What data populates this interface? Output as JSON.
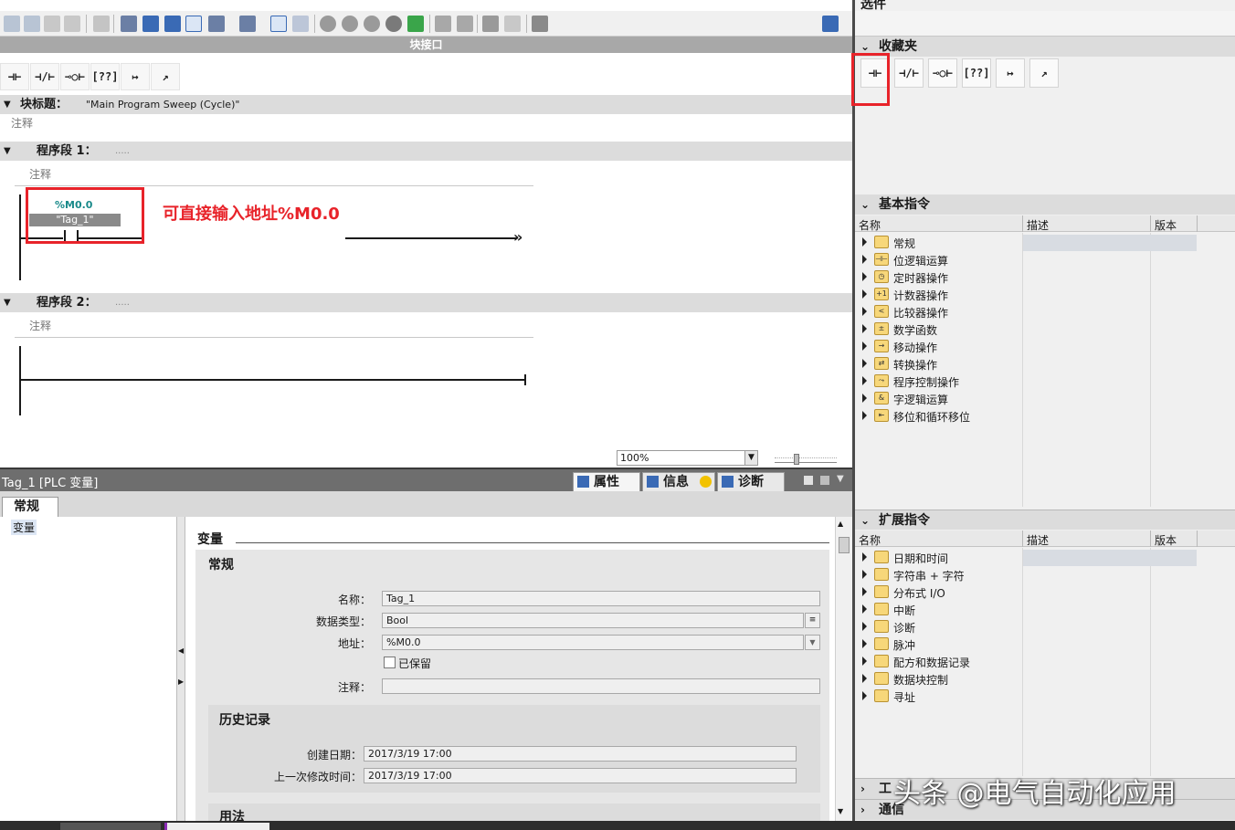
{
  "editor": {
    "block_interface_label": "块接口",
    "block_title_label": "块标题：",
    "block_title_value": "\"Main Program Sweep (Cycle)\"",
    "block_comment": "注释",
    "lad_buttons": [
      "⊣⊢",
      "⊣/⊢",
      "⊸○⊢",
      "[??]",
      "↦",
      "↗"
    ],
    "networks": [
      {
        "label": "程序段 1：",
        "dots": ".....",
        "comment": "注释"
      },
      {
        "label": "程序段 2：",
        "dots": ".....",
        "comment": "注释"
      }
    ],
    "contact_address": "%M0.0",
    "contact_tag": "\"Tag_1\"",
    "annotation": "可直接输入地址%M0.0",
    "zoom_value": "100%"
  },
  "inspector": {
    "title": "Tag_1 [PLC 变量]",
    "tab_properties": "属性",
    "tab_info": "信息",
    "tab_diagnostics": "诊断",
    "tab_general": "常规",
    "nav_item": "变量",
    "section_title": "变量",
    "group_general": "常规",
    "name_label": "名称：",
    "name_value": "Tag_1",
    "datatype_label": "数据类型：",
    "datatype_value": "Bool",
    "address_label": "地址：",
    "address_value": "%M0.0",
    "retain_label": "已保留",
    "comment_label": "注释：",
    "comment_value": "",
    "group_history": "历史记录",
    "created_label": "创建日期：",
    "created_value": "2017/3/19 17:00",
    "modified_label": "上一次修改时间：",
    "modified_value": "2017/3/19 17:00",
    "group_usage": "用法"
  },
  "taskcard": {
    "top_title": "选件",
    "favorites_title": "收藏夹",
    "basic_title": "基本指令",
    "extended_title": "扩展指令",
    "col_name": "名称",
    "col_desc": "描述",
    "col_version": "版本",
    "basic_items": [
      {
        "label": "常规",
        "icon": "folder-icon"
      },
      {
        "label": "位逻辑运算",
        "icon": "bit-logic-icon"
      },
      {
        "label": "定时器操作",
        "icon": "timer-icon"
      },
      {
        "label": "计数器操作",
        "icon": "counter-icon"
      },
      {
        "label": "比较器操作",
        "icon": "comparator-icon"
      },
      {
        "label": "数学函数",
        "icon": "math-icon"
      },
      {
        "label": "移动操作",
        "icon": "move-icon"
      },
      {
        "label": "转换操作",
        "icon": "convert-icon"
      },
      {
        "label": "程序控制操作",
        "icon": "program-control-icon"
      },
      {
        "label": "字逻辑运算",
        "icon": "word-logic-icon"
      },
      {
        "label": "移位和循环移位",
        "icon": "shift-icon"
      }
    ],
    "extended_items": [
      {
        "label": "日期和时间"
      },
      {
        "label": "字符串 + 字符"
      },
      {
        "label": "分布式 I/O"
      },
      {
        "label": "中断"
      },
      {
        "label": "诊断"
      },
      {
        "label": "脉冲"
      },
      {
        "label": "配方和数据记录"
      },
      {
        "label": "数据块控制"
      },
      {
        "label": "寻址"
      }
    ],
    "bottom_item_1": "工",
    "bottom_item_2": "通信"
  },
  "watermark": "头条 @电气自动化应用",
  "colors": {
    "annotation_red": "#e8232a",
    "address_teal": "#1a8a8a",
    "tag_highlight": "#8a8a8a"
  }
}
